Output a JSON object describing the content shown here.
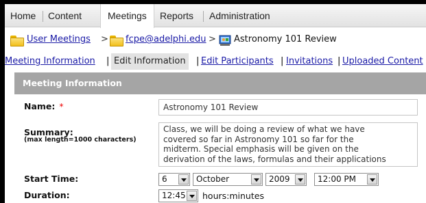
{
  "nav": {
    "home": "Home",
    "content": "Content",
    "meetings": "Meetings",
    "reports": "Reports",
    "administration": "Administration"
  },
  "breadcrumb": {
    "user_meetings": "User Meetings",
    "separator": ">",
    "folder": "fcpe@adelphi.edu",
    "meeting": "Astronomy 101 Review"
  },
  "subtabs": {
    "meeting_information": "Meeting Information",
    "edit_information": "Edit Information",
    "edit_participants": "Edit Participants",
    "invitations": "Invitations",
    "uploaded_content": "Uploaded Content",
    "divider": "|"
  },
  "panel": {
    "title": "Meeting Information"
  },
  "form": {
    "name_label": "Name:",
    "required_mark": "*",
    "name_value": "Astronomy 101 Review",
    "summary_label": "Summary:",
    "summary_hint": "(max length=1000 characters)",
    "summary_lines": [
      "Class, we will be doing a review of what we have",
      "covered so far in Astronomy 101 so far for the",
      "midterm. Special emphasis will be given on the",
      "derivation of the laws, formulas and their applications"
    ],
    "start_label": "Start Time:",
    "start_day": "6",
    "start_month": "October",
    "start_year": "2009",
    "start_time": "12:00 PM",
    "duration_label": "Duration:",
    "duration_value": "12:45",
    "duration_units": "hours:minutes"
  },
  "colors": {
    "panel_header": "#a5a5a5",
    "link": "#1a1aa6",
    "required": "#ee0000"
  }
}
